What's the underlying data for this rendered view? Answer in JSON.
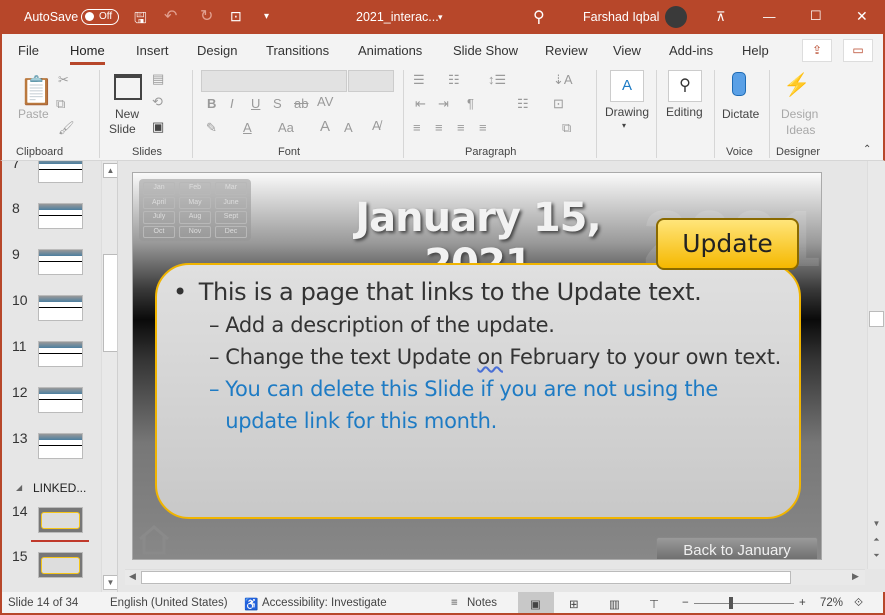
{
  "titlebar": {
    "autosave": "AutoSave",
    "autosave_state": "Off",
    "filename": "2021_interac...",
    "user": "Farshad Iqbal"
  },
  "tabs": [
    "File",
    "Home",
    "Insert",
    "Design",
    "Transitions",
    "Animations",
    "Slide Show",
    "Review",
    "View",
    "Add-ins",
    "Help"
  ],
  "active_tab": "Home",
  "ribbon": {
    "paste": "Paste",
    "new_slide_1": "New",
    "new_slide_2": "Slide",
    "drawing": "Drawing",
    "editing": "Editing",
    "dictate": "Dictate",
    "design_ideas_1": "Design",
    "design_ideas_2": "Ideas",
    "groups": {
      "clipboard": "Clipboard",
      "slides": "Slides",
      "font": "Font",
      "paragraph": "Paragraph",
      "voice": "Voice",
      "designer": "Designer"
    }
  },
  "thumbnails": {
    "numbers": [
      "7",
      "8",
      "9",
      "10",
      "11",
      "12",
      "13",
      "14",
      "15"
    ],
    "section": "LINKED..."
  },
  "slide": {
    "title": "January 15, 2021",
    "watermark": "2021",
    "months": [
      "Jan",
      "Feb",
      "Mar",
      "April",
      "May",
      "June",
      "July",
      "Aug",
      "Sept",
      "Oct",
      "Nov",
      "Dec"
    ],
    "update_button": "Update",
    "bullet": "This is a page that links to the Update text.",
    "sub1": "Add a description of the update.",
    "sub2_a": "Change the text Update ",
    "sub2_b": "on",
    "sub2_c": " February to your own text.",
    "sub3": "You can delete this Slide if you are not using the update link for this month.",
    "back_button": "Back to January",
    "link_color": "#1e7bc4",
    "accent": "#f5b800"
  },
  "status": {
    "slide": "Slide 14 of 34",
    "language": "English (United States)",
    "accessibility": "Accessibility: Investigate",
    "notes": "Notes",
    "zoom": "72%"
  },
  "theme_color": "#b7472a"
}
